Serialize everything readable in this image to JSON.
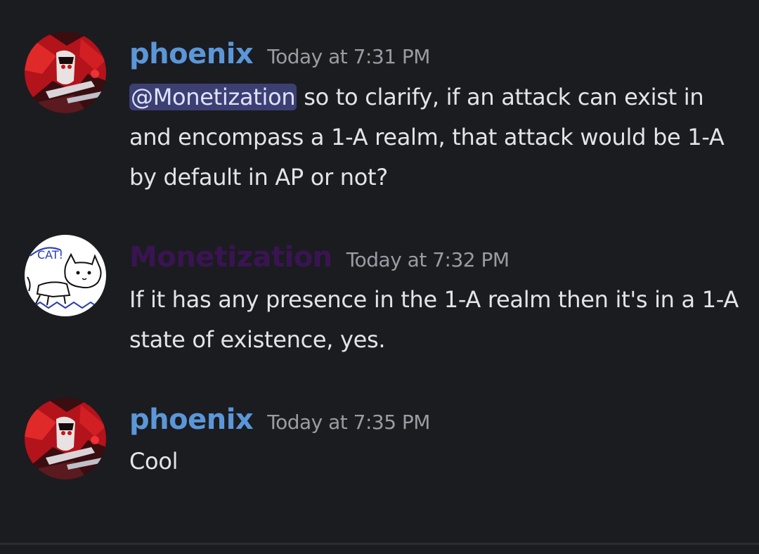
{
  "colors": {
    "background": "#1b1c20",
    "phoenix_name": "#5b97d8",
    "monetization_name": "#3a1452",
    "mention_bg": "#3b3f72",
    "timestamp": "#9b9ca3",
    "text": "#e3e4e8"
  },
  "messages": [
    {
      "author": "phoenix",
      "timestamp": "Today at 7:31 PM",
      "avatar_icon": "red-haired-character-avatar",
      "mention": "@Monetization",
      "text": " so to clarify, if an attack can exist in and encompass a 1-A realm, that attack would be 1-A by default in AP or not?"
    },
    {
      "author": "Monetization",
      "timestamp": "Today at 7:32 PM",
      "avatar_icon": "cat-doodle-avatar",
      "avatar_label": "CAT!",
      "text": "If it has any presence in the 1-A realm then it's in a 1-A state of existence, yes."
    },
    {
      "author": "phoenix",
      "timestamp": "Today at 7:35 PM",
      "avatar_icon": "red-haired-character-avatar",
      "text": "Cool"
    }
  ]
}
